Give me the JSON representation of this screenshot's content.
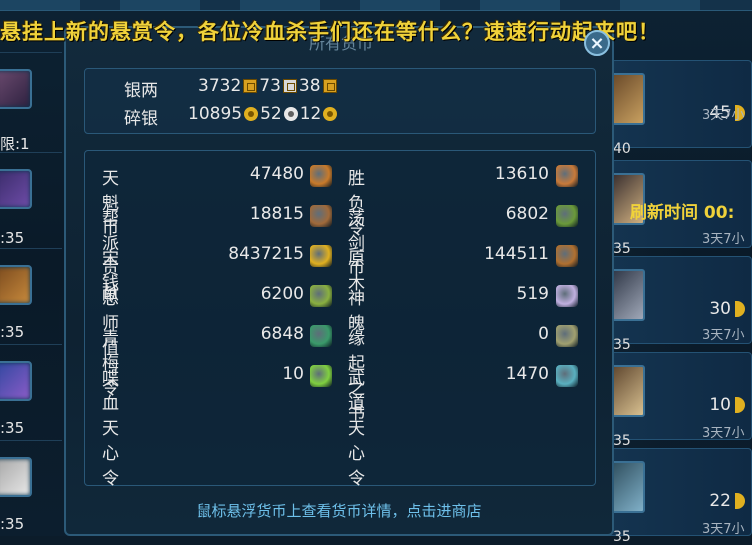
{
  "banner": "悬挂上新的悬赏令，各位冷血杀手们还在等什么？速速行动起来吧！",
  "panel_title": "所有货币",
  "close_glyph": "×",
  "left_col": [
    "限:1",
    ":35",
    ":35",
    ":35",
    ":35"
  ],
  "right_col": [
    {
      "num": "45",
      "small": "3天7小"
    },
    {
      "num": "",
      "small": "3天7小"
    },
    {
      "num": "30",
      "small": "3天7小"
    },
    {
      "num": "10",
      "small": "3天7小"
    },
    {
      "num": "22",
      "small": "3天7小"
    }
  ],
  "right_left_nums": [
    "40",
    "35",
    "35",
    "35",
    "35"
  ],
  "refresh_label": "刷新时间  00:",
  "silver": {
    "label": "银两",
    "v1": "3732",
    "v2": "73",
    "v3": "38"
  },
  "scrap_silver": {
    "label": "碎银",
    "v1": "10895",
    "v2": "52",
    "v3": "12"
  },
  "currencies_left": [
    {
      "label": "天魁币",
      "value": "47480",
      "icon": "coin-bronze-icon",
      "color": "#c87a2a"
    },
    {
      "label": "帮派贡献",
      "value": "18815",
      "icon": "guild-emblem-icon",
      "color": "#a06a3a"
    },
    {
      "label": "宋钱",
      "value": "8437215",
      "icon": "song-coin-icon",
      "color": "#e0b020"
    },
    {
      "label": "恩师值",
      "value": "6200",
      "icon": "mentor-icon",
      "color": "#8ab040"
    },
    {
      "label": "青梅令",
      "value": "6848",
      "icon": "plum-token-icon",
      "color": "#3a9a6a"
    },
    {
      "label": "喋血天心令",
      "value": "10",
      "icon": "jade-token-icon",
      "color": "#80d040"
    }
  ],
  "currencies_right": [
    {
      "label": "胜负令",
      "value": "13610",
      "icon": "tag-icon",
      "color": "#c87a3a"
    },
    {
      "label": "荡剑币",
      "value": "6802",
      "icon": "sword-coin-icon",
      "color": "#6a9a3a"
    },
    {
      "label": "原木",
      "value": "144511",
      "icon": "wood-icon",
      "color": "#b07030"
    },
    {
      "label": "神魄",
      "value": "519",
      "icon": "spirit-orb-icon",
      "color": "#c0b0e0"
    },
    {
      "label": "缘起之书",
      "value": "0",
      "icon": "book-icon",
      "color": "#a0a070"
    },
    {
      "label": "武道天心令",
      "value": "1470",
      "icon": "martial-token-icon",
      "color": "#5ab0c0"
    }
  ],
  "footer": "鼠标悬浮货币上查看货币详情，点击进商店"
}
